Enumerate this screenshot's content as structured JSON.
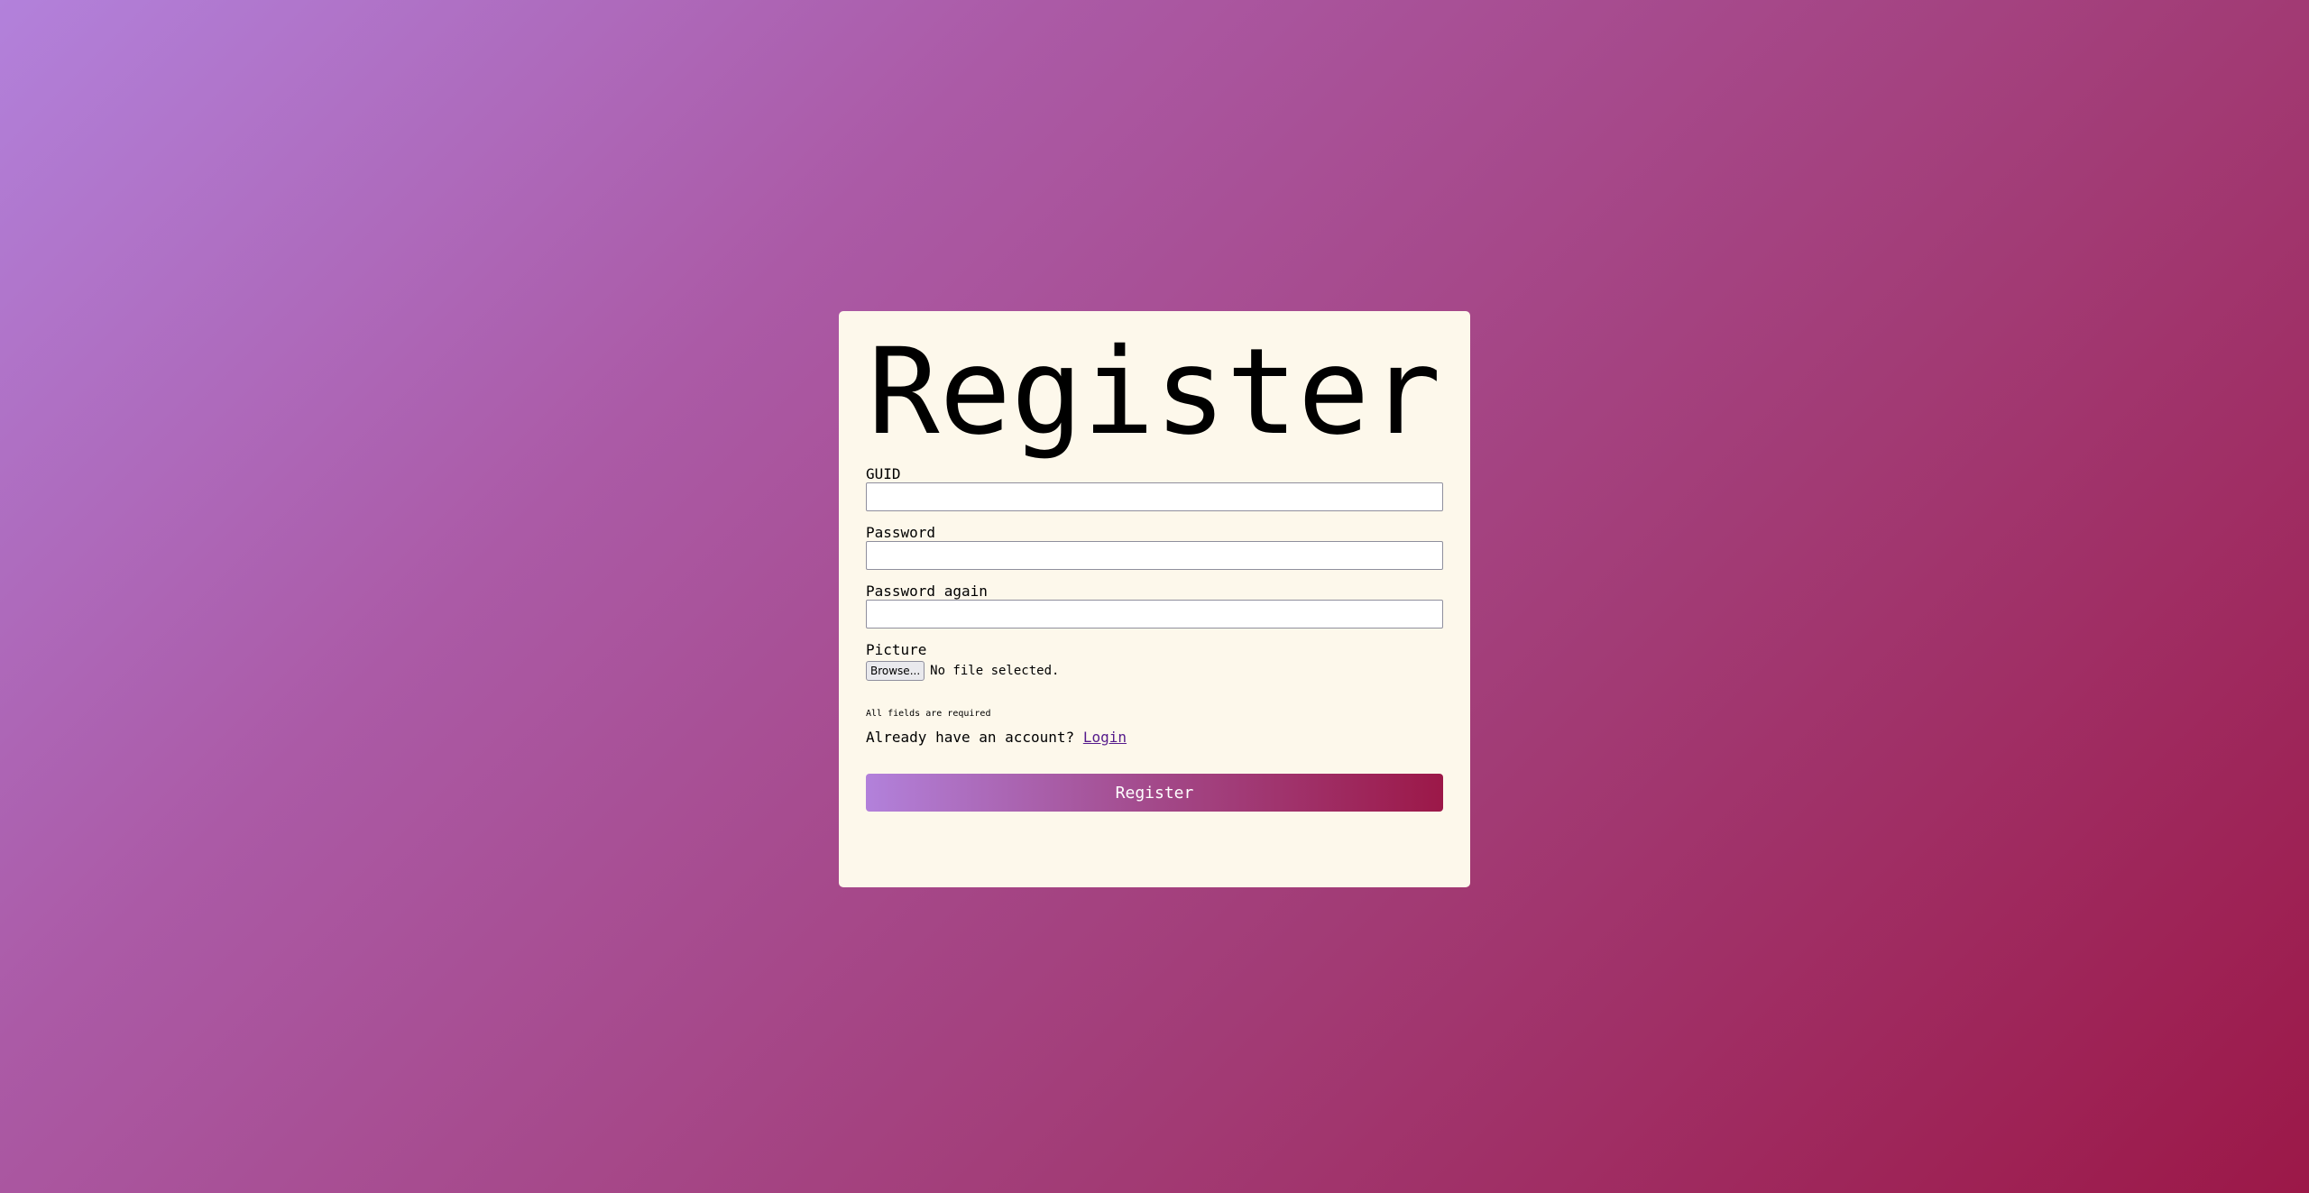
{
  "form": {
    "title": "Register",
    "fields": {
      "guid": {
        "label": "GUID",
        "value": "",
        "placeholder": ""
      },
      "password": {
        "label": "Password",
        "value": "",
        "placeholder": ""
      },
      "password_again": {
        "label": "Password again",
        "value": "",
        "placeholder": ""
      },
      "picture": {
        "label": "Picture",
        "browse_label": "Browse...",
        "status": "No file selected."
      }
    },
    "note": "All fields are required",
    "account_prompt": "Already have an account?",
    "login_link": "Login",
    "submit_label": "Register"
  },
  "colors": {
    "card_background": "#fdf8eb",
    "gradient_start": "#b281db",
    "gradient_end": "#9c1848",
    "link": "#551a8b"
  }
}
